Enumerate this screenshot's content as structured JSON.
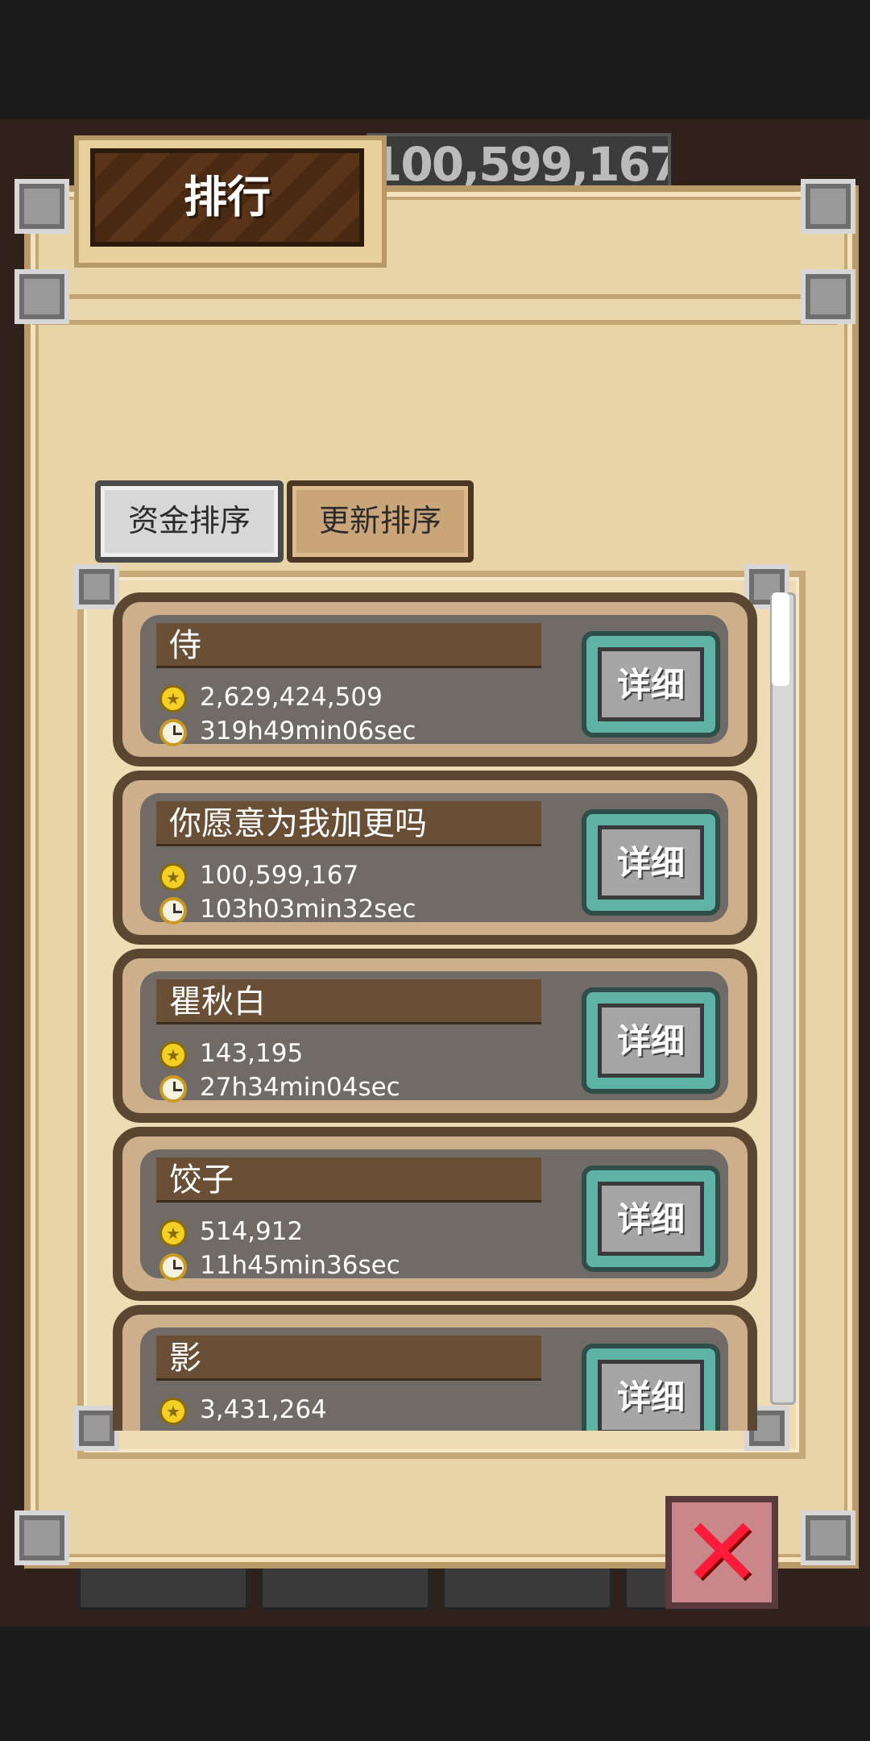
{
  "background": {
    "top_money": "100,599,167"
  },
  "dialog": {
    "title": "排行",
    "tabs": [
      {
        "label": "资金排序",
        "selected": false
      },
      {
        "label": "更新排序",
        "selected": true
      }
    ],
    "detail_label": "详细",
    "rows": [
      {
        "name": "侍",
        "money": "2,629,424,509",
        "time": "319h49min06sec"
      },
      {
        "name": "你愿意为我加更吗",
        "money": "100,599,167",
        "time": "103h03min32sec"
      },
      {
        "name": "瞿秋白",
        "money": "143,195",
        "time": "27h34min04sec"
      },
      {
        "name": "饺子",
        "money": "514,912",
        "time": "11h45min36sec"
      },
      {
        "name": "影",
        "money": "3,431,264",
        "time": ""
      }
    ],
    "close_icon": "close-x-icon"
  },
  "colors": {
    "parchment": "#e9d4a7",
    "row_border": "#5b4631",
    "detail_button": "#5fb3a5",
    "close_red": "#ff1a3a"
  }
}
